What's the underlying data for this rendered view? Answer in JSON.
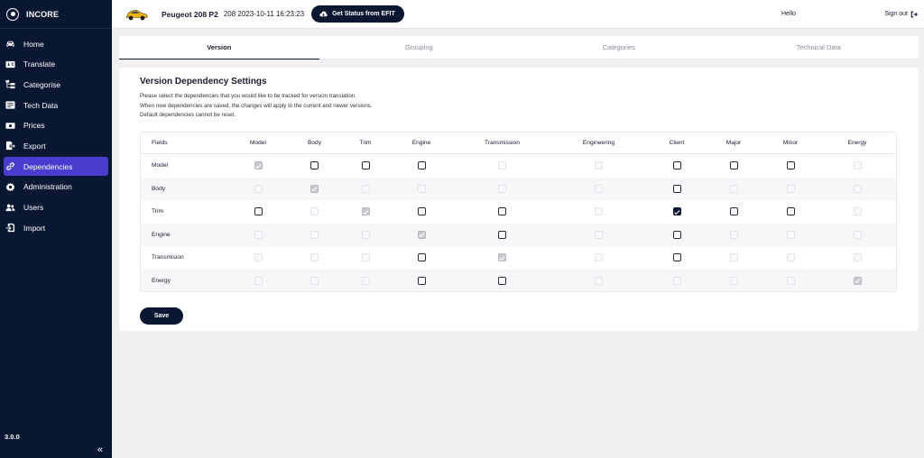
{
  "sidebar": {
    "brand": "INCORE",
    "items": [
      {
        "label": "Home",
        "icon": "car-icon",
        "active": false
      },
      {
        "label": "Translate",
        "icon": "translate-icon",
        "active": false
      },
      {
        "label": "Categorise",
        "icon": "hierarchy-icon",
        "active": false
      },
      {
        "label": "Tech Data",
        "icon": "document-icon",
        "active": false
      },
      {
        "label": "Prices",
        "icon": "money-icon",
        "active": false
      },
      {
        "label": "Export",
        "icon": "export-icon",
        "active": false
      },
      {
        "label": "Dependencies",
        "icon": "link-icon",
        "active": true
      },
      {
        "label": "Administration",
        "icon": "gear-icon",
        "active": false
      },
      {
        "label": "Users",
        "icon": "users-icon",
        "active": false
      },
      {
        "label": "Import",
        "icon": "import-icon",
        "active": false
      }
    ],
    "version": "3.0.0",
    "collapse_glyph": "«"
  },
  "header": {
    "car_name": "Peugeot 208 P2",
    "car_meta": "208 2023-10-11 16:23:23",
    "efit_button": "Get Status from EFIT",
    "greeting": "Hello",
    "signout": "Sign out"
  },
  "tabs": [
    {
      "label": "Version",
      "active": true
    },
    {
      "label": "Grouping",
      "active": false
    },
    {
      "label": "Categories",
      "active": false
    },
    {
      "label": "Technical Data",
      "active": false
    }
  ],
  "card": {
    "title": "Version Dependency Settings",
    "desc_lines": [
      "Please select the dependencies that you would like to be tracked for version translation.",
      "When new dependencies are saved, the changes will apply to the current and newer versions.",
      "Default dependencies cannot be reset."
    ],
    "save_label": "Save"
  },
  "grid": {
    "field_header": "Fields",
    "columns": [
      "Model",
      "Body",
      "Trim",
      "Engine",
      "Transmission",
      "Engineering",
      "Client",
      "Major",
      "Minor",
      "Energy"
    ],
    "rows": [
      {
        "field": "Model",
        "states": [
          "checked-disabled",
          "active",
          "active",
          "active",
          "disabled",
          "disabled",
          "active",
          "active",
          "active",
          "disabled"
        ]
      },
      {
        "field": "Body",
        "states": [
          "disabled",
          "checked-disabled",
          "disabled",
          "disabled",
          "disabled",
          "disabled",
          "active",
          "disabled",
          "disabled",
          "disabled"
        ]
      },
      {
        "field": "Trim",
        "states": [
          "active",
          "disabled",
          "checked-disabled",
          "active",
          "active",
          "disabled",
          "checked",
          "active",
          "active",
          "disabled"
        ]
      },
      {
        "field": "Engine",
        "states": [
          "disabled",
          "disabled",
          "disabled",
          "checked-disabled",
          "active",
          "disabled",
          "active",
          "disabled",
          "disabled",
          "disabled"
        ]
      },
      {
        "field": "Transmision",
        "states": [
          "disabled",
          "disabled",
          "disabled",
          "active",
          "checked-disabled",
          "disabled",
          "active",
          "disabled",
          "disabled",
          "disabled"
        ]
      },
      {
        "field": "Energy",
        "states": [
          "disabled",
          "disabled",
          "disabled",
          "active",
          "active",
          "disabled",
          "disabled",
          "disabled",
          "disabled",
          "checked-disabled"
        ]
      }
    ]
  }
}
